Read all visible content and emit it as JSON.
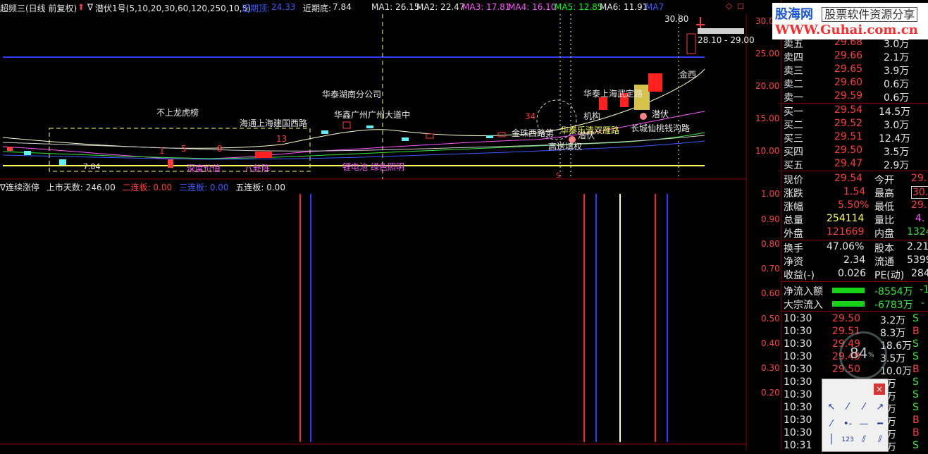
{
  "topbar": {
    "title": "超频三(日线 前复权)",
    "indicator": "潜伏1号(5,10,20,30,60,120,250,10,5)",
    "recent_high_label": "近期顶:",
    "recent_high": "24.33",
    "recent_low_label": "近期底:",
    "recent_low": "7.84",
    "ma1": "MA1: 26.15",
    "ma2": "MA2: 22.47",
    "ma3": "MA3: 17.81",
    "ma4": "MA4: 16.10",
    "ma5": "MA5: 12.85",
    "ma6": "MA6: 11.91",
    "ma7": "MA7"
  },
  "main_chart": {
    "axis_ticks": [
      "30.00",
      "25.00",
      "20.00",
      "15.00",
      "10.00"
    ],
    "high_price_label": "30.80",
    "range_label": "28.10 - 29.00",
    "annotations": {
      "no_dragon_tiger": "不上龙虎榜",
      "haitong": "海通上海建国西路",
      "huatai_hunan": "华泰湖南分公司",
      "huaxin": "华鑫广州广州大道中",
      "jinzhu": "金珠西路第",
      "huatai_shanghai": "华泰上海武定路",
      "jigou": "机构",
      "qianfu1": "潜伏",
      "qianfu2": "潜伏",
      "changcheng": "长城仙桃钱沟路",
      "quanxi": "金西",
      "gaosong": "高送填权",
      "yanchuan": "华泰乐清双雁路",
      "lithium": "锂电池 绿色照明",
      "deep_value": "深度价值",
      "eight_doors": "八卦阵",
      "num_34": "34",
      "num_13": "13",
      "num_1": "1",
      "num_5": "5",
      "num_8": "8",
      "low_label": "7.84",
      "s_marker": "S"
    }
  },
  "sub_chart": {
    "title": "连续涨停",
    "days_label": "上市天数: 246.00",
    "two_board": "二连板: 0.00",
    "three_board": "三连板: 0.00",
    "five_board": "五连板: 0.00",
    "axis_ticks": [
      "1.00",
      "0.90",
      "0.80",
      "0.70",
      "0.60",
      "0.50",
      "0.40",
      "0.30",
      "0.20"
    ]
  },
  "logo": {
    "brand": "股海网",
    "tagline": "股票软件资源分享",
    "url": "WWW.Guhai.com.cn"
  },
  "quote": {
    "asks": [
      {
        "label": "卖五",
        "price": "29.68",
        "vol": "3.0万"
      },
      {
        "label": "卖四",
        "price": "29.66",
        "vol": "2.1万"
      },
      {
        "label": "卖三",
        "price": "29.65",
        "vol": "3.9万"
      },
      {
        "label": "卖二",
        "price": "29.60",
        "vol": "0.6万"
      },
      {
        "label": "卖一",
        "price": "29.59",
        "vol": "0.6万"
      }
    ],
    "bids": [
      {
        "label": "买一",
        "price": "29.54",
        "vol": "14.5万"
      },
      {
        "label": "买二",
        "price": "29.52",
        "vol": "3.0万"
      },
      {
        "label": "买三",
        "price": "29.51",
        "vol": "12.4万"
      },
      {
        "label": "买四",
        "price": "29.50",
        "vol": "3.5万"
      },
      {
        "label": "买五",
        "price": "29.47",
        "vol": "2.9万"
      }
    ],
    "stats": [
      {
        "l1": "现价",
        "v1": "29.54",
        "l2": "今开",
        "v2": "29."
      },
      {
        "l1": "涨跌",
        "v1": "1.54",
        "l2": "最高",
        "v2": "30."
      },
      {
        "l1": "涨幅",
        "v1": "5.50%",
        "l2": "最低",
        "v2": "29."
      },
      {
        "l1": "总量",
        "v1": "254114",
        "l2": "量比",
        "v2": "4."
      },
      {
        "l1": "外盘",
        "v1": "121669",
        "l2": "内盘",
        "v2": "1324"
      }
    ],
    "stats2": [
      {
        "l1": "换手",
        "v1": "47.06%",
        "l2": "股本",
        "v2": "2.21"
      },
      {
        "l1": "净资",
        "v1": "2.34",
        "l2": "流通",
        "v2": "5399"
      },
      {
        "l1": "收益(-)",
        "v1": "0.026",
        "l2": "PE(动)",
        "v2": "284"
      }
    ],
    "flows": [
      {
        "label": "净流入额",
        "value": "-8554万",
        "tail": "-1"
      },
      {
        "label": "大宗流入",
        "value": "-6783万",
        "tail": "-"
      }
    ],
    "ticks": [
      {
        "time": "10:30",
        "price": "29.50",
        "vol": "3.2万",
        "side": "S"
      },
      {
        "time": "10:30",
        "price": "29.51",
        "vol": "8.3万",
        "side": "B"
      },
      {
        "time": "10:30",
        "price": "29.49",
        "vol": "18.6万",
        "side": "S"
      },
      {
        "time": "10:30",
        "price": "29.49",
        "vol": "3.5万",
        "side": "S"
      },
      {
        "time": "10:30",
        "price": "29.50",
        "vol": "10.0万",
        "side": "B"
      },
      {
        "time": "10:30",
        "price": "",
        "vol": "2万",
        "side": "S"
      },
      {
        "time": "10:30",
        "price": "",
        "vol": "0万",
        "side": "S"
      },
      {
        "time": "10:30",
        "price": "",
        "vol": "3万",
        "side": "S"
      },
      {
        "time": "10:30",
        "price": "",
        "vol": "1万",
        "side": "B"
      },
      {
        "time": "10:30",
        "price": "",
        "vol": "7万",
        "side": "B"
      },
      {
        "time": "10:31",
        "price": "",
        "vol": "5万",
        "side": "S"
      }
    ],
    "gauge_value": "84",
    "gauge_unit": "%"
  },
  "colors": {
    "up": "#ff3b3b",
    "down": "#35e835",
    "axis": "#ff4040",
    "panel_border": "#8a0000"
  }
}
